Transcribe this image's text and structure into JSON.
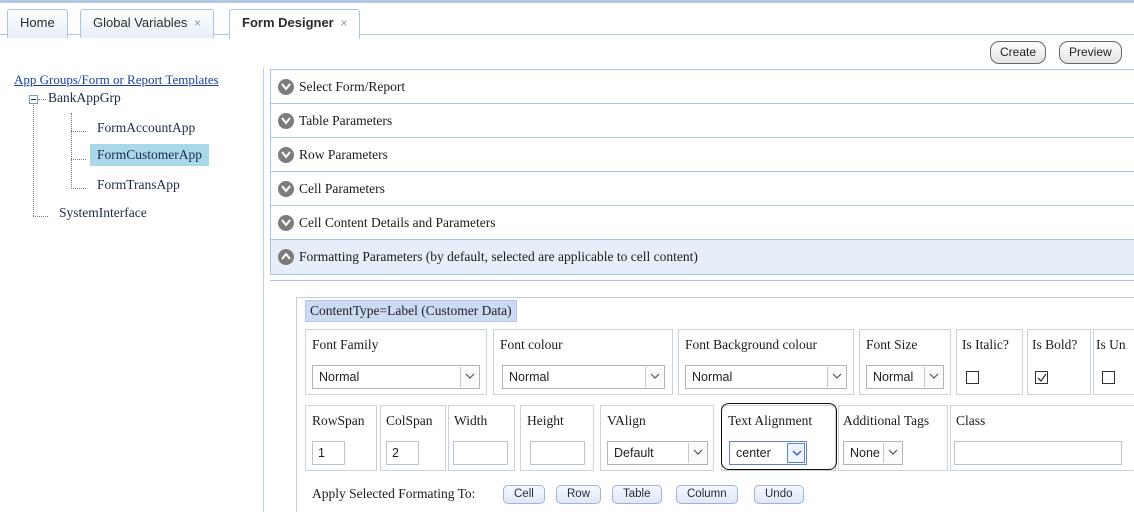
{
  "tabs": [
    {
      "label": "Home",
      "closable": false
    },
    {
      "label": "Global Variables",
      "closable": true
    },
    {
      "label": "Form Designer",
      "closable": true,
      "active": true
    }
  ],
  "tab_close_glyph": "×",
  "toolbar": {
    "create_label": "Create",
    "preview_label": "Preview"
  },
  "tree": {
    "root_link": "App Groups/Form or Report Templates",
    "group": "BankAppGrp",
    "children": [
      "FormAccountApp",
      "FormCustomerApp",
      "FormTransApp"
    ],
    "selected": "FormCustomerApp",
    "sibling": "SystemInterface"
  },
  "accordion": [
    {
      "label": "Select Form/Report",
      "open": false
    },
    {
      "label": "Table Parameters",
      "open": false
    },
    {
      "label": "Row Parameters",
      "open": false
    },
    {
      "label": "Cell Parameters",
      "open": false
    },
    {
      "label": "Cell Content Details and Parameters",
      "open": false
    },
    {
      "label": "Formatting Parameters (by default, selected are applicable to cell content)",
      "open": true
    }
  ],
  "formatting": {
    "content_type": "ContentType=Label (Customer Data)",
    "font_family": {
      "label": "Font Family",
      "value": "Normal"
    },
    "font_colour": {
      "label": "Font colour",
      "value": "Normal"
    },
    "font_bg_colour": {
      "label": "Font Background colour",
      "value": "Normal"
    },
    "font_size": {
      "label": "Font Size",
      "value": "Normal"
    },
    "is_italic": {
      "label": "Is Italic?",
      "checked": false
    },
    "is_bold": {
      "label": "Is Bold?",
      "checked": true
    },
    "is_underline": {
      "label": "Is Un",
      "checked": false
    },
    "rowspan": {
      "label": "RowSpan",
      "value": "1"
    },
    "colspan": {
      "label": "ColSpan",
      "value": "2"
    },
    "width": {
      "label": "Width",
      "value": ""
    },
    "height": {
      "label": "Height",
      "value": ""
    },
    "valign": {
      "label": "VAlign",
      "value": "Default"
    },
    "text_alignment": {
      "label": "Text Alignment",
      "value": "center"
    },
    "additional_tags": {
      "label": "Additional Tags",
      "value": "None"
    },
    "class": {
      "label": "Class",
      "value": ""
    },
    "apply_label": "Apply Selected Formating To:",
    "apply_buttons": [
      "Cell",
      "Row",
      "Table",
      "Column",
      "Undo"
    ]
  },
  "colors": {
    "accent_border": "#aac4e6",
    "selected_tree": "#a9d8ea",
    "content_type_bg": "#cddaf3",
    "open_section_bg": "#e6eef9"
  }
}
